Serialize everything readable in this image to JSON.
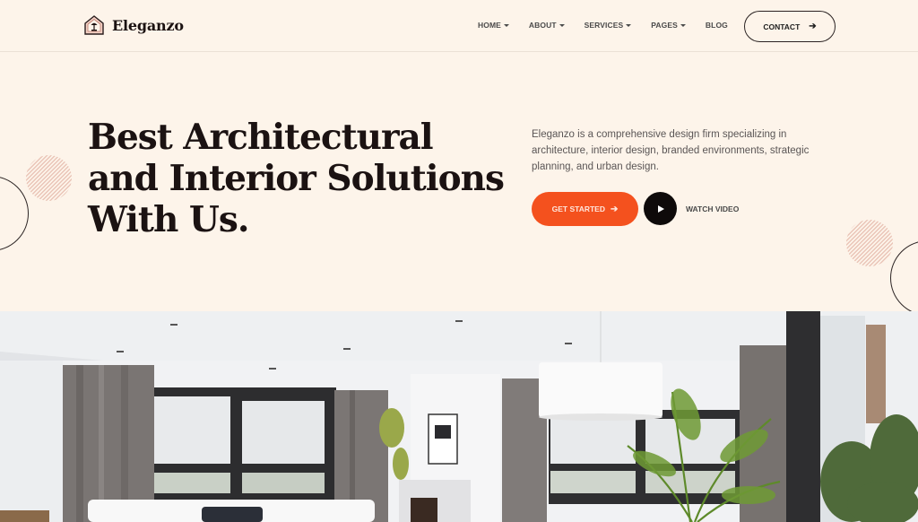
{
  "brand": {
    "name": "Eleganzo",
    "logo_icon": "house-lamp-icon"
  },
  "nav": {
    "items": [
      {
        "label": "HOME",
        "has_dropdown": true
      },
      {
        "label": "ABOUT",
        "has_dropdown": true
      },
      {
        "label": "SERVICES",
        "has_dropdown": true
      },
      {
        "label": "PAGES",
        "has_dropdown": true
      },
      {
        "label": "BLOG",
        "has_dropdown": false
      }
    ],
    "contact_label": "CONTACT",
    "contact_icon": "arrow-right-icon"
  },
  "hero": {
    "title_lines": [
      "Best Architectural",
      "and Interior Solutions",
      "With Us."
    ],
    "description": "Eleganzo is a comprehensive design firm specializing in architecture, interior design, branded environments, strategic planning, and urban design.",
    "cta_label": "GET STARTED",
    "cta_icon": "arrow-right-icon",
    "video_label": "WATCH VIDEO",
    "video_icon": "play-icon"
  },
  "image": {
    "description": "Modern living room interior with large windows, grey curtains, white pendant lamp and palm plants"
  },
  "colors": {
    "background": "#fdf4ea",
    "accent": "#f4511e",
    "dark": "#1b1212",
    "hatch": "#e8c0b2"
  }
}
